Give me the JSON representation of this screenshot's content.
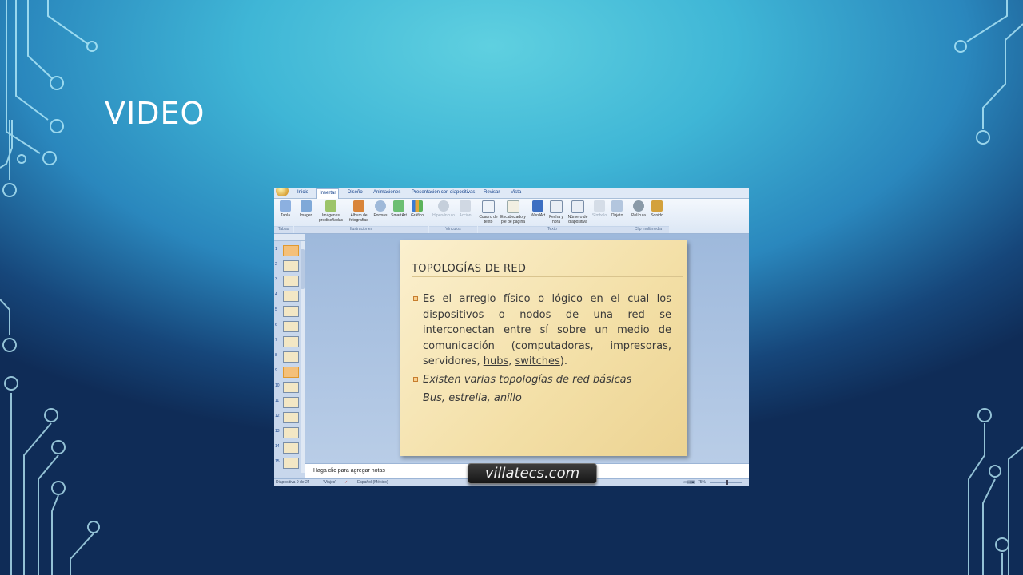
{
  "slide": {
    "title": "VIDEO"
  },
  "ribbon": {
    "tabs": [
      "Inicio",
      "Insertar",
      "Diseño",
      "Animaciones",
      "Presentación con diapositivas",
      "Revisar",
      "Vista"
    ],
    "buttons": [
      "Tabla",
      "Imagen",
      "Imágenes prediseñadas",
      "Álbum de fotografías",
      "Formas",
      "SmartArt",
      "Gráfico",
      "Hipervínculo",
      "Acción",
      "Cuadro de texto",
      "Encabezado y pie de página",
      "WordArt",
      "Fecha y hora",
      "Número de diapositiva",
      "Símbolo",
      "Objeto",
      "Película",
      "Sonido"
    ],
    "groups": [
      "Tablas",
      "Ilustraciones",
      "Vínculos",
      "Texto",
      "Clip multimedia"
    ]
  },
  "thumbnails": {
    "numbers": [
      "1",
      "2",
      "3",
      "4",
      "5",
      "6",
      "7",
      "8",
      "9",
      "10",
      "11",
      "12",
      "13",
      "14",
      "15"
    ]
  },
  "embedded_slide": {
    "heading": "TOPOLOGÍAS DE RED",
    "bullet1_before": "Es el arreglo físico o lógico en el cual los dispositivos o nodos de una red se interconectan entre sí sobre un medio de comunicación (computadoras, impresoras, servidores, ",
    "bullet1_link1": "hubs",
    "bullet1_sep": ", ",
    "bullet1_link2": "switches",
    "bullet1_after": ").",
    "bullet2": "Existen varias topologías de red básicas",
    "bullet3": "Bus, estrella, anillo"
  },
  "notes_placeholder": "Haga clic para agregar notas",
  "statusbar": {
    "slide_info": "Diapositiva 9 de 24",
    "theme": "\"Viajes\"",
    "language": "Español (México)",
    "zoom": "75%"
  },
  "watermark": "villatecs.com",
  "colors": {
    "text": "#ffffff",
    "circuit": "#bff3ff"
  }
}
